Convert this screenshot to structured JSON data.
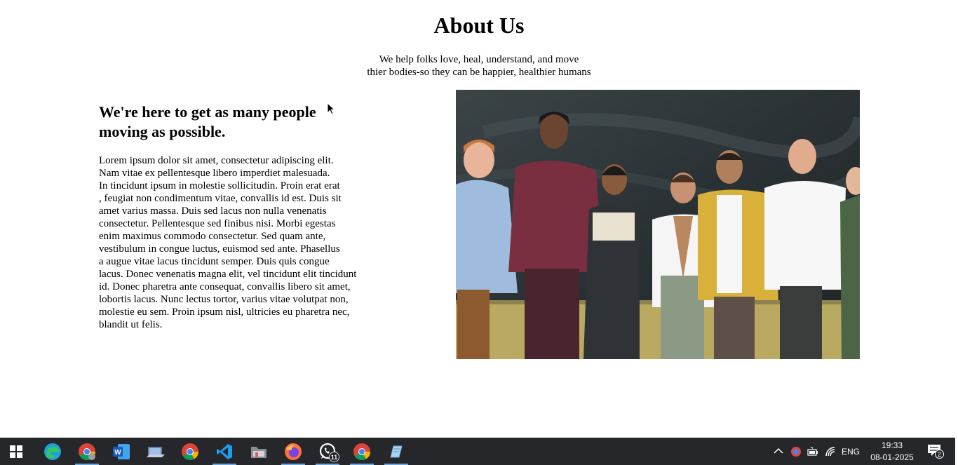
{
  "page": {
    "title": "About Us",
    "subtitle_lines": [
      "We help folks love, heal, understand, and move",
      "thier bodies-so they can be happier, healthier humans"
    ]
  },
  "about": {
    "heading_lines": [
      "We're here to get as many people",
      "moving as possible."
    ],
    "body_lines": [
      "Lorem ipsum dolor sit amet, consectetur adipiscing elit.",
      "Nam vitae ex pellentesque libero imperdiet malesuada.",
      "In tincidunt ipsum in molestie sollicitudin. Proin erat erat",
      ", feugiat non condimentum vitae, convallis id est. Duis sit",
      "amet varius massa. Duis sed lacus non nulla venenatis",
      "consectetur. Pellentesque sed finibus nisi. Morbi egestas",
      "enim maximus commodo consectetur. Sed quam ante,",
      "vestibulum in congue luctus, euismod sed ante. Phasellus",
      "a augue vitae lacus tincidunt semper. Duis quis congue",
      "lacus. Donec venenatis magna elit, vel tincidunt elit tincidunt",
      "id. Donec pharetra ante consequat, convallis libero sit amet,",
      "lobortis lacus. Nunc lectus tortor, varius vitae volutpat non,",
      "molestie eu sem. Proin ipsum nisl, ultricies eu pharetra nec,",
      "blandit ut felis."
    ]
  },
  "taskbar": {
    "apps": [
      {
        "icon": "windows-start-icon"
      },
      {
        "icon": "edge-icon"
      },
      {
        "icon": "chrome-profile-icon",
        "active": true
      },
      {
        "icon": "word-icon"
      },
      {
        "icon": "file-explorer-icon"
      },
      {
        "icon": "chrome-icon"
      },
      {
        "icon": "vscode-icon",
        "active": true
      },
      {
        "icon": "folder-icon"
      },
      {
        "icon": "firefox-icon",
        "active": true
      },
      {
        "icon": "whatsapp-icon",
        "active": true,
        "badge": "11"
      },
      {
        "icon": "chrome-alt-icon",
        "active": true
      },
      {
        "icon": "notepad-icon",
        "active": true
      }
    ],
    "tray": {
      "language": "ENG",
      "time": "19:33",
      "date": "08-01-2025",
      "notification_count": "2"
    }
  }
}
